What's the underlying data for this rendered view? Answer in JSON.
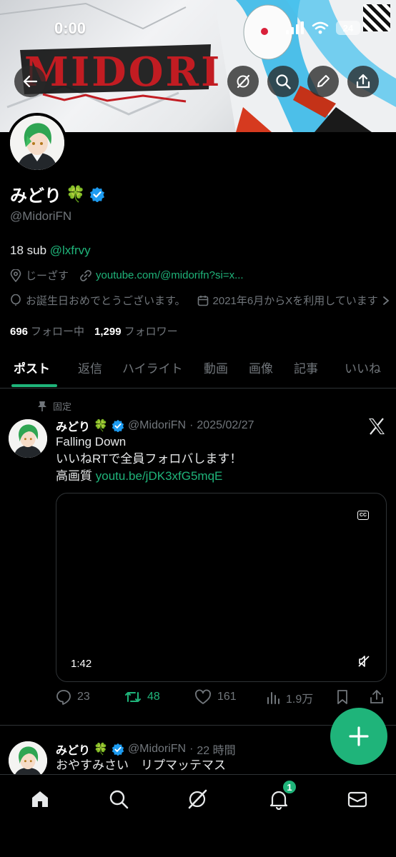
{
  "status_bar": {
    "time": "0:00",
    "battery": "24"
  },
  "banner": {
    "logo_text": "MIDORI"
  },
  "profile": {
    "name": "みどり",
    "name_emoji": "🍀",
    "handle": "@MidoriFN",
    "bio_text": "18 sub ",
    "bio_mention": "@lxfrvy",
    "location": "じーざす",
    "website": "youtube.com/@midorifn?si=x...",
    "birthday": "お誕生日おめでとうございます。",
    "joined": "2021年6月からXを利用しています",
    "following_count": "696",
    "following_label": "フォロー中",
    "followers_count": "1,299",
    "followers_label": "フォロワー"
  },
  "tabs": [
    "ポスト",
    "返信",
    "ハイライト",
    "動画",
    "画像",
    "記事",
    "いいね"
  ],
  "posts": [
    {
      "pinned_label": "固定",
      "name": "みどり",
      "emoji": "🍀",
      "handle": "@MidoriFN",
      "sep": "·",
      "time": "2025/02/27",
      "line1": "Falling Down",
      "line2": "いいねRTで全員フォロバします！",
      "line3_prefix": "高画質 ",
      "line3_link": "youtu.be/jDK3xfG5mqE",
      "video_duration": "1:42",
      "replies": "23",
      "reposts": "48",
      "likes": "161",
      "views": "1.9万"
    },
    {
      "name": "みどり",
      "emoji": "🍀",
      "handle": "@MidoriFN",
      "sep": "·",
      "time": "22 時間",
      "line1": "おやすみさい　リプマッテマス"
    }
  ],
  "nav": {
    "notifications_badge": "1"
  },
  "colors": {
    "accent": "#1fb47a",
    "verified": "#1d9bf0",
    "muted": "#71767b",
    "background": "#000000"
  }
}
